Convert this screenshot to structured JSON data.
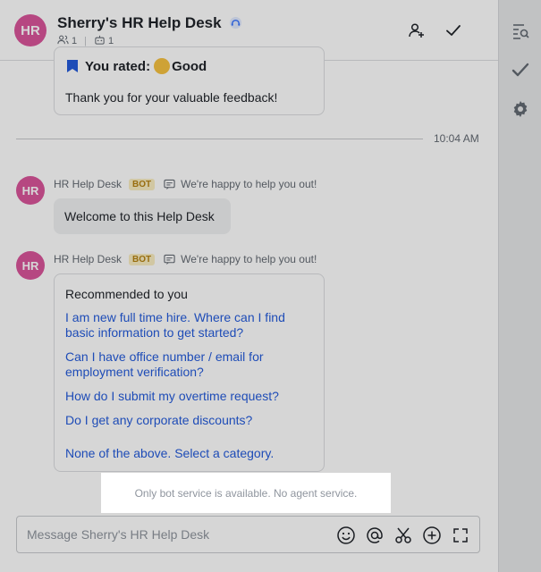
{
  "header": {
    "avatar_initials": "HR",
    "title": "Sherry's HR Help Desk",
    "member_count": "1",
    "bot_count": "1"
  },
  "feedback": {
    "rated_label": "You rated:",
    "rating": "Good",
    "thanks": "Thank you for your valuable feedback!"
  },
  "divider_time": "10:04 AM",
  "messages": [
    {
      "avatar": "HR",
      "sender": "HR Help Desk",
      "badge": "BOT",
      "thread": "We're happy to help you out!",
      "text": "Welcome to this Help Desk"
    },
    {
      "avatar": "HR",
      "sender": "HR Help Desk",
      "badge": "BOT",
      "thread": "We're happy to help you out!"
    }
  ],
  "recommend": {
    "title": "Recommended to you",
    "links": [
      "I am new full time hire. Where can I find basic information to get started?",
      "Can I have office number / email for employment verification?",
      "How do I submit my overtime request?",
      "Do I get any corporate discounts?",
      "None of the above. Select a category."
    ]
  },
  "notice": "Only bot service is available. No agent service.",
  "composer": {
    "placeholder": "Message Sherry's HR Help Desk"
  },
  "colors": {
    "avatar": "#d9559a",
    "link": "#245bdb",
    "bot_badge_bg": "#faedc2",
    "bot_badge_text": "#b58211"
  }
}
